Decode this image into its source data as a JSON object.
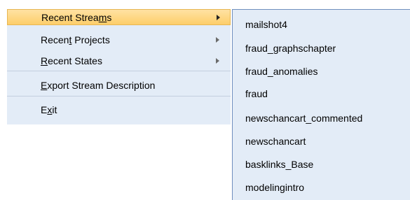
{
  "menu": {
    "items": [
      {
        "pre": "Recent Strea",
        "u": "m",
        "post": "s",
        "has_submenu": true,
        "active": true
      },
      {
        "pre": "Recen",
        "u": "t",
        "post": " Projects",
        "has_submenu": true,
        "active": false
      },
      {
        "pre": "",
        "u": "R",
        "post": "ecent States",
        "has_submenu": true,
        "active": false
      },
      {
        "pre": "",
        "u": "E",
        "post": "xport Stream Description",
        "has_submenu": false,
        "active": false
      },
      {
        "pre": "E",
        "u": "x",
        "post": "it",
        "has_submenu": false,
        "active": false
      }
    ]
  },
  "submenu": {
    "items": [
      "mailshot4",
      "fraud_graphschapter",
      "fraud_anomalies",
      "fraud",
      "newschancart_commented",
      "newschancart",
      "basklinks_Base",
      "modelingintro"
    ]
  },
  "colors": {
    "menu_background": "#e3ecf7",
    "highlight": "#fdce6a",
    "submenu_border": "#6f8fbe"
  }
}
